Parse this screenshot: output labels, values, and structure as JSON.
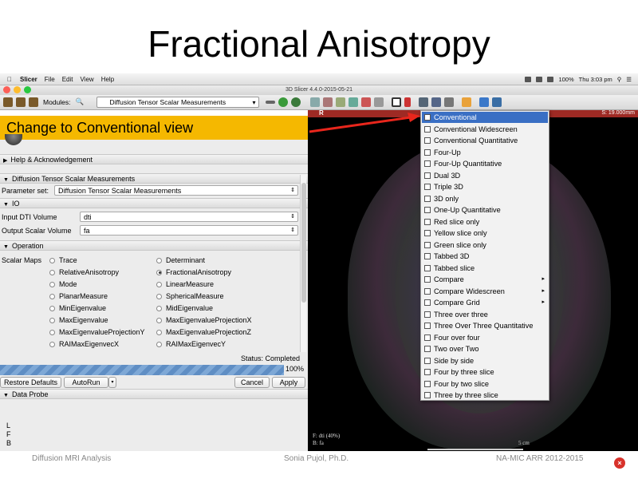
{
  "slide": {
    "title": "Fractional Anisotropy",
    "footer_left": "Diffusion MRI Analysis",
    "footer_mid": "Sonia Pujol, Ph.D.",
    "footer_right": "NA-MIC ARR 2012-2015",
    "close_glyph": "×"
  },
  "menubar": {
    "app": "Slicer",
    "items": [
      "File",
      "Edit",
      "View",
      "Help"
    ],
    "battery": "100%",
    "clock": "Thu 3:03 pm"
  },
  "window": {
    "title": "3D Slicer 4.4.0-2015-05-21"
  },
  "toolbar": {
    "modules_label": "Modules:",
    "module_selected": "Diffusion Tensor Scalar Measurements"
  },
  "banner": {
    "text": "Change to Conventional view"
  },
  "panel": {
    "help_section": "Help & Acknowledgement",
    "module_section": "Diffusion Tensor Scalar Measurements",
    "param_label": "Parameter set:",
    "param_value": "Diffusion Tensor Scalar Measurements",
    "io_section": "IO",
    "input_label": "Input DTI Volume",
    "input_value": "dti",
    "output_label": "Output Scalar Volume",
    "output_value": "fa",
    "operation_section": "Operation",
    "scalar_maps_label": "Scalar Maps",
    "radios_left": [
      "Trace",
      "RelativeAnisotropy",
      "Mode",
      "PlanarMeasure",
      "MinEigenvalue",
      "MaxEigenvalue",
      "MaxEigenvalueProjectionY",
      "RAIMaxEigenvecX"
    ],
    "radios_right": [
      "Determinant",
      "FractionalAnisotropy",
      "LinearMeasure",
      "SphericalMeasure",
      "MidEigenvalue",
      "MaxEigenvalueProjectionX",
      "MaxEigenvalueProjectionZ",
      "RAIMaxEigenvecY"
    ],
    "selected_radio": "FractionalAnisotropy",
    "status": "Status: Completed",
    "progress_text": "100%",
    "progress_fraction": 1.0,
    "restore_button": "Restore Defaults",
    "autorun_button": "AutoRun",
    "cancel_button": "Cancel",
    "apply_button": "Apply",
    "probe_section": "Data Probe",
    "orient": [
      "L",
      "F",
      "B"
    ]
  },
  "viewer": {
    "slice_letter": "R",
    "slice_offset": "S: 19.000mm",
    "info_line1": "F: dti (40%)",
    "info_line2": "B: fa",
    "scale_label": "5 cm"
  },
  "layout_menu": {
    "selected": "Conventional",
    "items": [
      {
        "label": "Conventional",
        "sub": false
      },
      {
        "label": "Conventional Widescreen",
        "sub": false
      },
      {
        "label": "Conventional Quantitative",
        "sub": false
      },
      {
        "label": "Four-Up",
        "sub": false
      },
      {
        "label": "Four-Up Quantitative",
        "sub": false
      },
      {
        "label": "Dual 3D",
        "sub": false
      },
      {
        "label": "Triple 3D",
        "sub": false
      },
      {
        "label": "3D only",
        "sub": false
      },
      {
        "label": "One-Up Quantitative",
        "sub": false
      },
      {
        "label": "Red slice only",
        "sub": false
      },
      {
        "label": "Yellow slice only",
        "sub": false
      },
      {
        "label": "Green slice only",
        "sub": false
      },
      {
        "label": "Tabbed 3D",
        "sub": false
      },
      {
        "label": "Tabbed slice",
        "sub": false
      },
      {
        "label": "Compare",
        "sub": true
      },
      {
        "label": "Compare Widescreen",
        "sub": true
      },
      {
        "label": "Compare Grid",
        "sub": true
      },
      {
        "label": "Three over three",
        "sub": false
      },
      {
        "label": "Three Over Three Quantitative",
        "sub": false
      },
      {
        "label": "Four over four",
        "sub": false
      },
      {
        "label": "Two over Two",
        "sub": false
      },
      {
        "label": "Side by side",
        "sub": false
      },
      {
        "label": "Four by three slice",
        "sub": false
      },
      {
        "label": "Four by two slice",
        "sub": false
      },
      {
        "label": "Three by three slice",
        "sub": false
      }
    ]
  },
  "colors": {
    "banner": "#f5b800",
    "menu_highlight": "#3a6fc4",
    "slice_bar": "#9e2a24",
    "arrow": "#e8261c"
  }
}
